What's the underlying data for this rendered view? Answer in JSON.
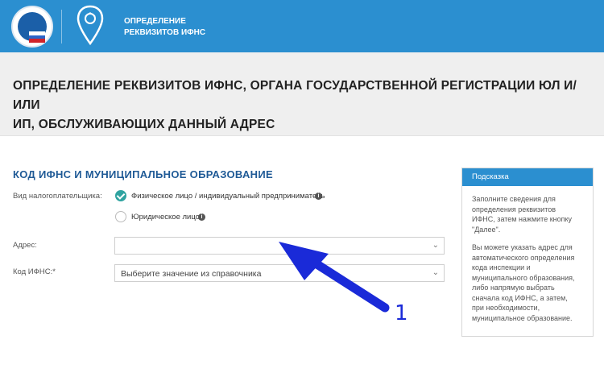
{
  "header": {
    "title_line1": "Определение",
    "title_line2": "реквизитов ИФНС"
  },
  "page": {
    "title_line1": "ОПРЕДЕЛЕНИЕ РЕКВИЗИТОВ ИФНС, ОРГАНА ГОСУДАРСТВЕННОЙ РЕГИСТРАЦИИ ЮЛ И/ИЛИ",
    "title_line2": "ИП, ОБСЛУЖИВАЮЩИХ ДАННЫЙ АДРЕС"
  },
  "form": {
    "section_title": "КОД ИФНС И МУНИЦИПАЛЬНОЕ ОБРАЗОВАНИЕ",
    "taxpayer_label": "Вид налогоплательщика:",
    "option_individual": "Физическое лицо / индивидуальный предприниматель",
    "option_legal": "Юридическое лицо",
    "info_glyph": "i",
    "address_label": "Адрес:",
    "address_value": "",
    "ifns_label": "Код ИФНС:*",
    "ifns_placeholder": "Выберите значение из справочника",
    "selected_option": "individual"
  },
  "hint": {
    "title": "Подсказка",
    "p1": [
      "Заполните сведения для",
      "определения реквизитов",
      "ИФНС, затем нажмите кнопку",
      "\"Далее\"."
    ],
    "p2": [
      "Вы можете указать адрес для",
      "автоматического определения",
      "кода инспекции и",
      "муниципального образования,",
      "либо напрямую выбрать",
      "сначала код ИФНС, а затем,",
      "при необходимости,",
      "муниципальное образование."
    ]
  },
  "annotation": {
    "number": "1",
    "color": "#1a2ad8"
  },
  "colors": {
    "header_blue": "#2b8fd0",
    "accent_teal": "#2fa3a0",
    "section_blue": "#1f5a96"
  },
  "icons": {
    "logo": "fns-emblem",
    "pin": "location-pin-icon",
    "chevron": "chevron-down-icon",
    "info": "info-icon",
    "check": "check-icon"
  }
}
